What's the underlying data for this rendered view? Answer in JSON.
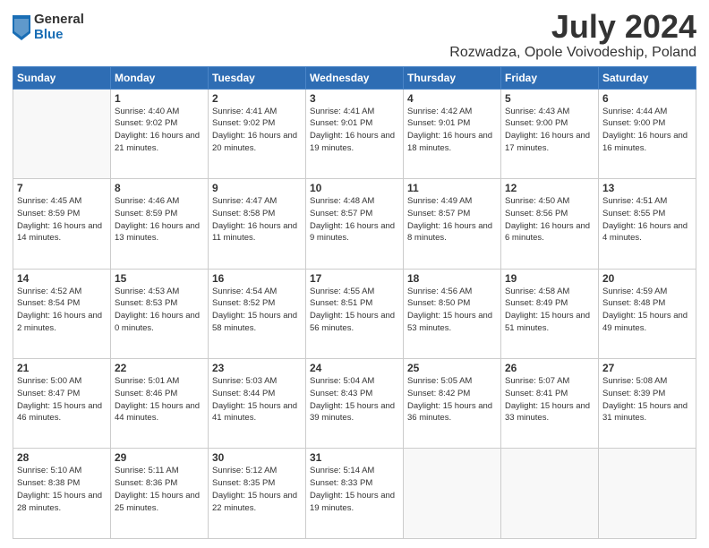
{
  "logo": {
    "general": "General",
    "blue": "Blue"
  },
  "title": "July 2024",
  "subtitle": "Rozwadza, Opole Voivodeship, Poland",
  "days_of_week": [
    "Sunday",
    "Monday",
    "Tuesday",
    "Wednesday",
    "Thursday",
    "Friday",
    "Saturday"
  ],
  "weeks": [
    [
      {
        "day": "",
        "sunrise": "",
        "sunset": "",
        "daylight": ""
      },
      {
        "day": "1",
        "sunrise": "Sunrise: 4:40 AM",
        "sunset": "Sunset: 9:02 PM",
        "daylight": "Daylight: 16 hours and 21 minutes."
      },
      {
        "day": "2",
        "sunrise": "Sunrise: 4:41 AM",
        "sunset": "Sunset: 9:02 PM",
        "daylight": "Daylight: 16 hours and 20 minutes."
      },
      {
        "day": "3",
        "sunrise": "Sunrise: 4:41 AM",
        "sunset": "Sunset: 9:01 PM",
        "daylight": "Daylight: 16 hours and 19 minutes."
      },
      {
        "day": "4",
        "sunrise": "Sunrise: 4:42 AM",
        "sunset": "Sunset: 9:01 PM",
        "daylight": "Daylight: 16 hours and 18 minutes."
      },
      {
        "day": "5",
        "sunrise": "Sunrise: 4:43 AM",
        "sunset": "Sunset: 9:00 PM",
        "daylight": "Daylight: 16 hours and 17 minutes."
      },
      {
        "day": "6",
        "sunrise": "Sunrise: 4:44 AM",
        "sunset": "Sunset: 9:00 PM",
        "daylight": "Daylight: 16 hours and 16 minutes."
      }
    ],
    [
      {
        "day": "7",
        "sunrise": "Sunrise: 4:45 AM",
        "sunset": "Sunset: 8:59 PM",
        "daylight": "Daylight: 16 hours and 14 minutes."
      },
      {
        "day": "8",
        "sunrise": "Sunrise: 4:46 AM",
        "sunset": "Sunset: 8:59 PM",
        "daylight": "Daylight: 16 hours and 13 minutes."
      },
      {
        "day": "9",
        "sunrise": "Sunrise: 4:47 AM",
        "sunset": "Sunset: 8:58 PM",
        "daylight": "Daylight: 16 hours and 11 minutes."
      },
      {
        "day": "10",
        "sunrise": "Sunrise: 4:48 AM",
        "sunset": "Sunset: 8:57 PM",
        "daylight": "Daylight: 16 hours and 9 minutes."
      },
      {
        "day": "11",
        "sunrise": "Sunrise: 4:49 AM",
        "sunset": "Sunset: 8:57 PM",
        "daylight": "Daylight: 16 hours and 8 minutes."
      },
      {
        "day": "12",
        "sunrise": "Sunrise: 4:50 AM",
        "sunset": "Sunset: 8:56 PM",
        "daylight": "Daylight: 16 hours and 6 minutes."
      },
      {
        "day": "13",
        "sunrise": "Sunrise: 4:51 AM",
        "sunset": "Sunset: 8:55 PM",
        "daylight": "Daylight: 16 hours and 4 minutes."
      }
    ],
    [
      {
        "day": "14",
        "sunrise": "Sunrise: 4:52 AM",
        "sunset": "Sunset: 8:54 PM",
        "daylight": "Daylight: 16 hours and 2 minutes."
      },
      {
        "day": "15",
        "sunrise": "Sunrise: 4:53 AM",
        "sunset": "Sunset: 8:53 PM",
        "daylight": "Daylight: 16 hours and 0 minutes."
      },
      {
        "day": "16",
        "sunrise": "Sunrise: 4:54 AM",
        "sunset": "Sunset: 8:52 PM",
        "daylight": "Daylight: 15 hours and 58 minutes."
      },
      {
        "day": "17",
        "sunrise": "Sunrise: 4:55 AM",
        "sunset": "Sunset: 8:51 PM",
        "daylight": "Daylight: 15 hours and 56 minutes."
      },
      {
        "day": "18",
        "sunrise": "Sunrise: 4:56 AM",
        "sunset": "Sunset: 8:50 PM",
        "daylight": "Daylight: 15 hours and 53 minutes."
      },
      {
        "day": "19",
        "sunrise": "Sunrise: 4:58 AM",
        "sunset": "Sunset: 8:49 PM",
        "daylight": "Daylight: 15 hours and 51 minutes."
      },
      {
        "day": "20",
        "sunrise": "Sunrise: 4:59 AM",
        "sunset": "Sunset: 8:48 PM",
        "daylight": "Daylight: 15 hours and 49 minutes."
      }
    ],
    [
      {
        "day": "21",
        "sunrise": "Sunrise: 5:00 AM",
        "sunset": "Sunset: 8:47 PM",
        "daylight": "Daylight: 15 hours and 46 minutes."
      },
      {
        "day": "22",
        "sunrise": "Sunrise: 5:01 AM",
        "sunset": "Sunset: 8:46 PM",
        "daylight": "Daylight: 15 hours and 44 minutes."
      },
      {
        "day": "23",
        "sunrise": "Sunrise: 5:03 AM",
        "sunset": "Sunset: 8:44 PM",
        "daylight": "Daylight: 15 hours and 41 minutes."
      },
      {
        "day": "24",
        "sunrise": "Sunrise: 5:04 AM",
        "sunset": "Sunset: 8:43 PM",
        "daylight": "Daylight: 15 hours and 39 minutes."
      },
      {
        "day": "25",
        "sunrise": "Sunrise: 5:05 AM",
        "sunset": "Sunset: 8:42 PM",
        "daylight": "Daylight: 15 hours and 36 minutes."
      },
      {
        "day": "26",
        "sunrise": "Sunrise: 5:07 AM",
        "sunset": "Sunset: 8:41 PM",
        "daylight": "Daylight: 15 hours and 33 minutes."
      },
      {
        "day": "27",
        "sunrise": "Sunrise: 5:08 AM",
        "sunset": "Sunset: 8:39 PM",
        "daylight": "Daylight: 15 hours and 31 minutes."
      }
    ],
    [
      {
        "day": "28",
        "sunrise": "Sunrise: 5:10 AM",
        "sunset": "Sunset: 8:38 PM",
        "daylight": "Daylight: 15 hours and 28 minutes."
      },
      {
        "day": "29",
        "sunrise": "Sunrise: 5:11 AM",
        "sunset": "Sunset: 8:36 PM",
        "daylight": "Daylight: 15 hours and 25 minutes."
      },
      {
        "day": "30",
        "sunrise": "Sunrise: 5:12 AM",
        "sunset": "Sunset: 8:35 PM",
        "daylight": "Daylight: 15 hours and 22 minutes."
      },
      {
        "day": "31",
        "sunrise": "Sunrise: 5:14 AM",
        "sunset": "Sunset: 8:33 PM",
        "daylight": "Daylight: 15 hours and 19 minutes."
      },
      {
        "day": "",
        "sunrise": "",
        "sunset": "",
        "daylight": ""
      },
      {
        "day": "",
        "sunrise": "",
        "sunset": "",
        "daylight": ""
      },
      {
        "day": "",
        "sunrise": "",
        "sunset": "",
        "daylight": ""
      }
    ]
  ]
}
